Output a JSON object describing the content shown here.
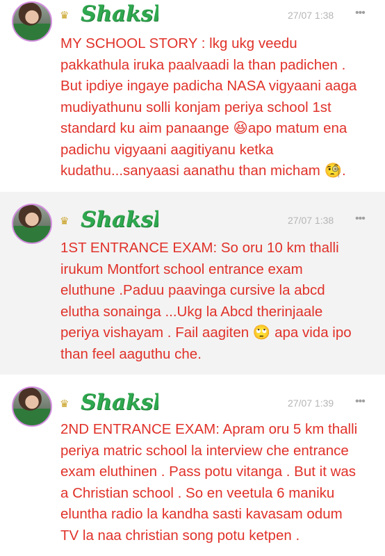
{
  "posts": [
    {
      "author": "Shakshi",
      "time": "27/07 1:38",
      "more": "•••",
      "crown": "♛",
      "body": "MY SCHOOL STORY : lkg ukg veedu\npakkathula iruka paalvaadi la than padichen .\nBut ipdiye ingaye padicha NASA vigyaani aaga\nmudiyathunu solli konjam periya school 1st\nstandard ku aim panaange 😆apo matum ena\npadichu vigyaani aagitiyanu ketka\nkudathu...sanyaasi aanathu than micham 🧐."
    },
    {
      "author": "Shakshi",
      "time": "27/07 1:38",
      "more": "•••",
      "crown": "♛",
      "body": "1ST ENTRANCE EXAM: So oru 10 km thalli\nirukum Montfort school entrance exam\neluthune .Paduu paavinga cursive la abcd\nelutha sonainga ...Ukg la Abcd therinjaale\nperiya vishayam . Fail aagiten 🙄 apa vida ipo\nthan feel aaguthu che."
    },
    {
      "author": "Shakshi",
      "time": "27/07 1:39",
      "more": "•••",
      "crown": "♛",
      "body": "2ND ENTRANCE EXAM: Apram oru 5 km thalli\nperiya matric school la interview che entrance\nexam eluthinen . Pass potu vitanga . But it was\na Christian school . So en veetula 6 maniku\neluntha radio la kandha sasti kavasam odum\nTV la naa christian song potu ketpen ."
    }
  ]
}
